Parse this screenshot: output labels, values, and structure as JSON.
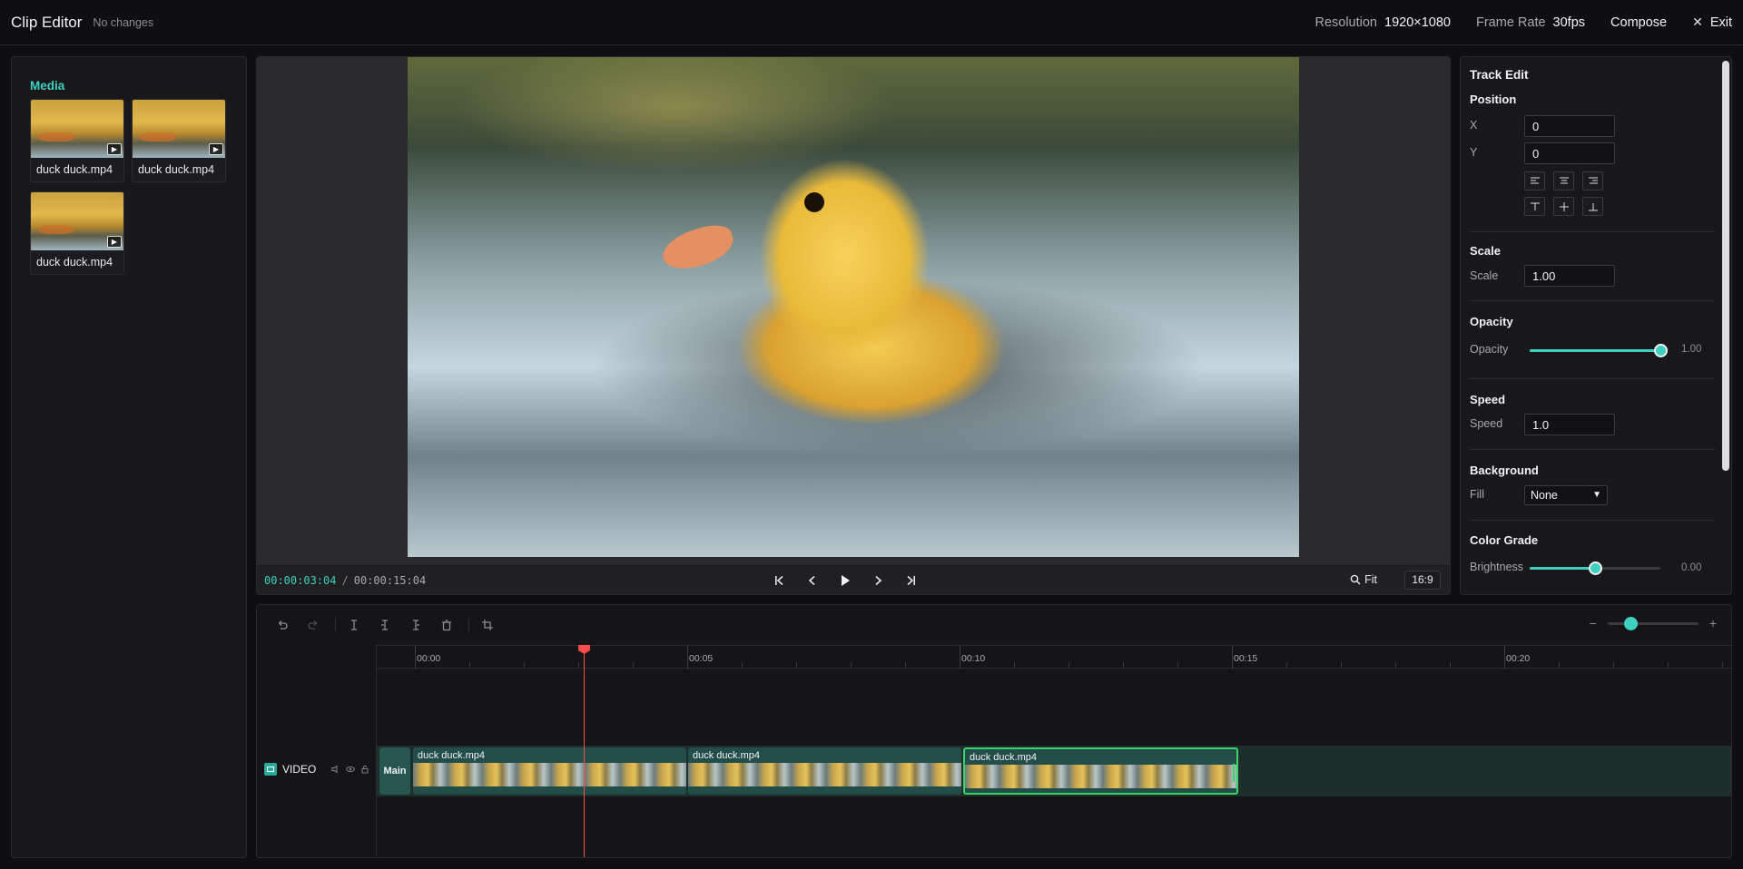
{
  "header": {
    "title": "Clip Editor",
    "status": "No changes",
    "resolution_label": "Resolution",
    "resolution_value": "1920×1080",
    "framerate_label": "Frame Rate",
    "framerate_value": "30fps",
    "compose_label": "Compose",
    "exit_label": "Exit"
  },
  "media": {
    "heading": "Media",
    "items": [
      {
        "name": "duck duck.mp4"
      },
      {
        "name": "duck duck.mp4"
      },
      {
        "name": "duck duck.mp4"
      }
    ]
  },
  "preview": {
    "current_time": "00:00:03:04",
    "separator": "/",
    "total_time": "00:00:15:04",
    "fit_label": "Fit",
    "aspect_label": "16:9"
  },
  "track_edit": {
    "title": "Track Edit",
    "position_heading": "Position",
    "x_label": "X",
    "x_value": "0",
    "y_label": "Y",
    "y_value": "0",
    "scale_heading": "Scale",
    "scale_label": "Scale",
    "scale_value": "1.00",
    "opacity_heading": "Opacity",
    "opacity_label": "Opacity",
    "opacity_value": "1.00",
    "opacity_level": 1.0,
    "speed_heading": "Speed",
    "speed_label": "Speed",
    "speed_value": "1.0",
    "background_heading": "Background",
    "fill_label": "Fill",
    "fill_value": "None",
    "color_grade_heading": "Color Grade",
    "brightness_label": "Brightness",
    "brightness_value": "0.00",
    "brightness_level": 0.5
  },
  "timeline": {
    "ruler_labels": [
      "00:00",
      "00:05",
      "00:10",
      "00:15",
      "00:20"
    ],
    "track_name": "VIDEO",
    "main_tag": "Main",
    "clips": [
      {
        "name": "duck duck.mp4",
        "selected": false
      },
      {
        "name": "duck duck.mp4",
        "selected": false
      },
      {
        "name": "duck duck.mp4",
        "selected": true
      }
    ],
    "playhead_time": "00:03:04"
  },
  "colors": {
    "accent": "#3ed0c1",
    "playhead": "#ff4c4c",
    "selection": "#37d66b"
  }
}
